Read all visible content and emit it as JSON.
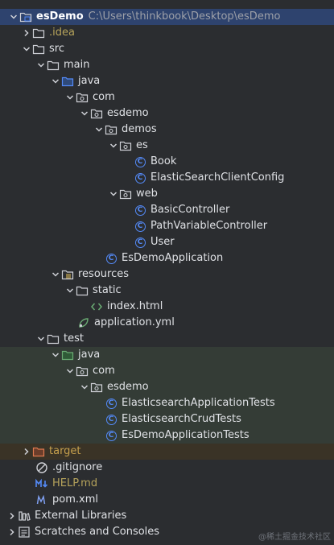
{
  "colors": {
    "background": "#2b2d30",
    "selected_row": "#2e436e",
    "test_source_band": "#343c36",
    "excluded_band": "#3a3326",
    "class_icon": "#548af7",
    "text": "#dfe1e5",
    "excluded_text": "#c6a04d"
  },
  "project": {
    "name": "esDemo",
    "path": "C:\\Users\\thinkbook\\Desktop\\esDemo"
  },
  "tree": {
    "idea": ".idea",
    "src": "src",
    "main": "main",
    "java": "java",
    "com": "com",
    "esdemo": "esdemo",
    "demos": "demos",
    "es": "es",
    "book": "Book",
    "es_client_config": "ElasticSearchClientConfig",
    "web": "web",
    "basic_controller": "BasicController",
    "path_variable_controller": "PathVariableController",
    "user": "User",
    "esdemo_application": "EsDemoApplication",
    "resources": "resources",
    "static": "static",
    "index_html": "index.html",
    "application_yml": "application.yml",
    "test": "test",
    "test_java": "java",
    "test_com": "com",
    "test_esdemo": "esdemo",
    "es_app_tests": "ElasticsearchApplicationTests",
    "es_crud_tests": "ElasticsearchCrudTests",
    "esdemo_app_tests": "EsDemoApplicationTests",
    "target": "target",
    "gitignore": ".gitignore",
    "help_md": "HELP.md",
    "pom_xml": "pom.xml",
    "external_libraries": "External Libraries",
    "scratches": "Scratches and Consoles"
  },
  "icons": {
    "chevron_down": "chevron-down-icon",
    "chevron_right": "chevron-right-icon",
    "folder": "folder-icon",
    "source_folder": "source-folder-icon",
    "test_folder": "test-folder-icon",
    "package": "package-icon",
    "class": "class-icon",
    "resources_folder": "resources-folder-icon",
    "html": "html-file-icon",
    "yaml": "yaml-file-icon",
    "excluded_folder": "excluded-folder-icon",
    "ignore": "ignore-file-icon",
    "markdown": "markdown-file-icon",
    "maven": "maven-file-icon",
    "library": "library-icon",
    "scratches": "scratches-icon"
  },
  "watermark": "@稀土掘金技术社区"
}
